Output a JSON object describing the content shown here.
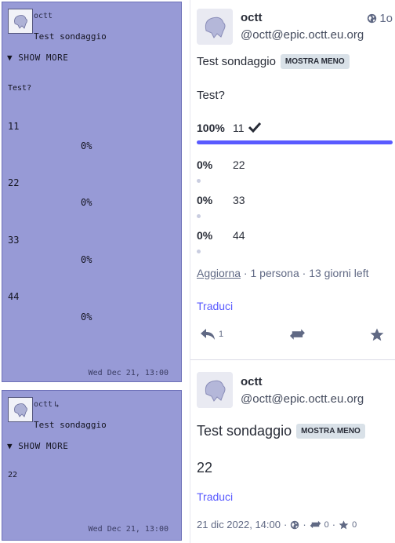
{
  "left": {
    "cards": [
      {
        "author": "octt",
        "title": "Test sondaggio",
        "toggle": "▼ SHOW MORE",
        "question": "Test?",
        "options": [
          {
            "label": "11",
            "percent": "0%"
          },
          {
            "label": "22",
            "percent": "0%"
          },
          {
            "label": "33",
            "percent": "0%"
          },
          {
            "label": "44",
            "percent": "0%"
          }
        ],
        "date": "Wed Dec 21, 13:00"
      },
      {
        "author": "octt",
        "repost_mark": "↳",
        "title": "Test sondaggio",
        "toggle": "▼ SHOW MORE",
        "body": "22",
        "date": "Wed Dec 21, 13:00"
      }
    ]
  },
  "right": {
    "posts": [
      {
        "display_name": "octt",
        "account": "@octt@epic.octt.eu.org",
        "age": "1o",
        "visibility_icon": "globe-icon",
        "title": "Test sondaggio",
        "toggle": "MOSTRA MENO",
        "question": "Test?",
        "poll": {
          "options": [
            {
              "percent": "100%",
              "label": "11",
              "fraction": 1.0,
              "chosen": true
            },
            {
              "percent": "0%",
              "label": "22",
              "fraction": 0.0,
              "chosen": false
            },
            {
              "percent": "0%",
              "label": "33",
              "fraction": 0.0,
              "chosen": false
            },
            {
              "percent": "0%",
              "label": "44",
              "fraction": 0.0,
              "chosen": false
            }
          ],
          "refresh_label": "Aggiorna",
          "voters": " · 1 persona · 13 giorni left"
        },
        "translate": "Traduci",
        "reply_count": "1",
        "accent": "#595aff"
      },
      {
        "display_name": "octt",
        "account": "@octt@epic.octt.eu.org",
        "title": "Test sondaggio",
        "toggle": "MOSTRA MENO",
        "body": "22",
        "translate": "Traduci",
        "date": "21 dic 2022, 14:00",
        "boosts": "0",
        "favourites": "0"
      }
    ]
  }
}
